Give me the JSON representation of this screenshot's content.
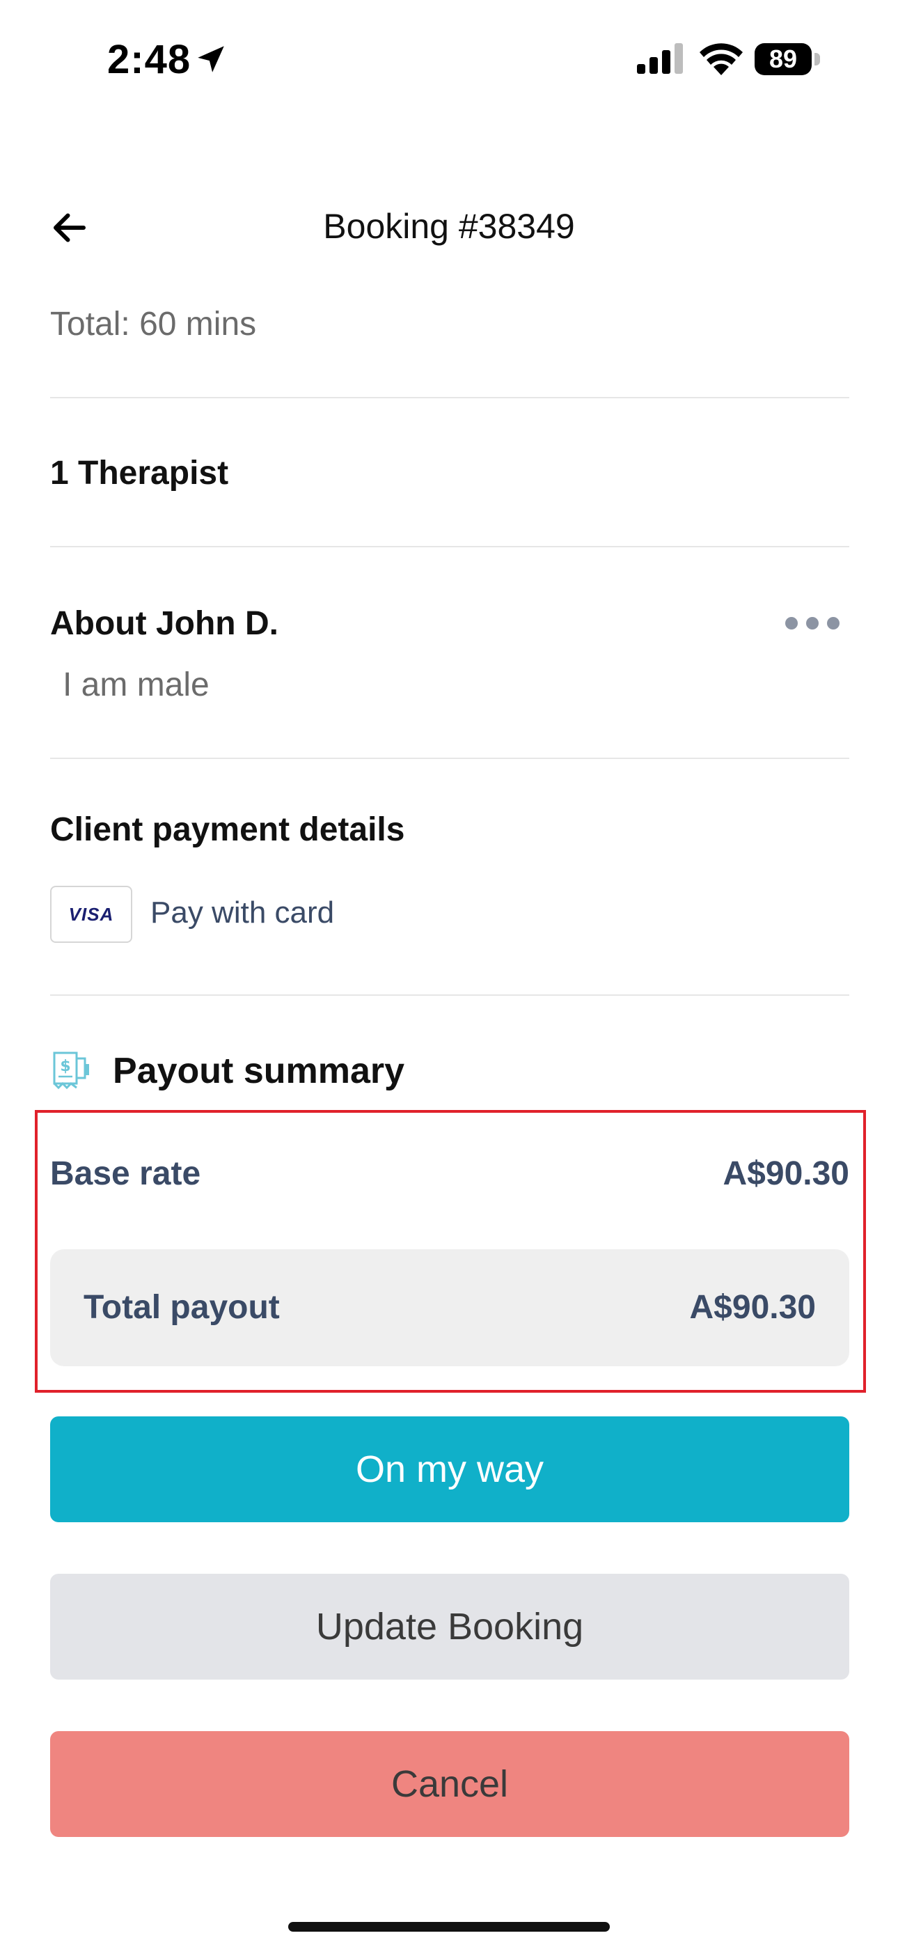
{
  "status_bar": {
    "time": "2:48",
    "battery": "89"
  },
  "header": {
    "title": "Booking #38349"
  },
  "booking": {
    "total_duration": "Total: 60 mins",
    "therapists": "1 Therapist",
    "about_title": "About John D.",
    "about_text": "I am male"
  },
  "payment": {
    "title": "Client payment details",
    "card_brand": "VISA",
    "method": "Pay with card"
  },
  "payout": {
    "title": "Payout summary",
    "base_rate_label": "Base rate",
    "base_rate_value": "A$90.30",
    "total_label": "Total payout",
    "total_value": "A$90.30"
  },
  "actions": {
    "on_my_way": "On my way",
    "update_booking": "Update Booking",
    "cancel": "Cancel"
  },
  "colors": {
    "primary": "#10b0c9",
    "secondary_button": "#e3e4e8",
    "danger": "#ef8580",
    "highlight": "#e0212b",
    "muted_text": "#6b6b6b",
    "value_text": "#3a4a66"
  }
}
